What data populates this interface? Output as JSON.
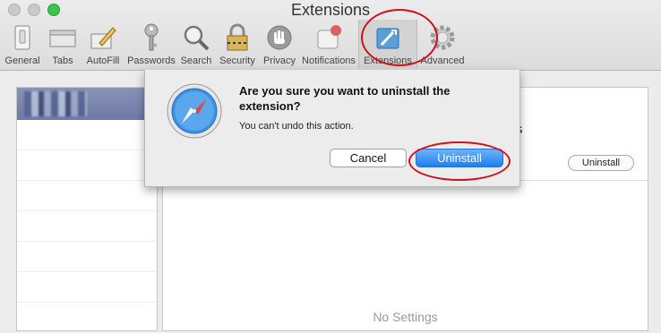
{
  "window": {
    "title": "Extensions"
  },
  "toolbar": {
    "items": [
      {
        "label": "General",
        "icon": "general-switch-icon"
      },
      {
        "label": "Tabs",
        "icon": "tabs-icon"
      },
      {
        "label": "AutoFill",
        "icon": "autofill-pencil-icon"
      },
      {
        "label": "Passwords",
        "icon": "key-icon"
      },
      {
        "label": "Search",
        "icon": "magnifier-icon"
      },
      {
        "label": "Security",
        "icon": "padlock-icon"
      },
      {
        "label": "Privacy",
        "icon": "hand-icon"
      },
      {
        "label": "Notifications",
        "icon": "notification-badge-icon"
      },
      {
        "label": "Extensions",
        "icon": "extensions-puzzle-icon"
      },
      {
        "label": "Advanced",
        "icon": "gear-icon"
      }
    ],
    "active": "Extensions"
  },
  "detail": {
    "extension_name_fragment": "kes",
    "uninstall_label": "Uninstall",
    "empty_text": "No Settings"
  },
  "dialog": {
    "question": "Are you sure you want to uninstall the extension?",
    "message": "You can't undo this action.",
    "cancel_label": "Cancel",
    "uninstall_label": "Uninstall"
  },
  "colors": {
    "accent": "#1f7ff0",
    "annotation_red": "#d0111b",
    "sidebar_selected": "#7883ad"
  }
}
